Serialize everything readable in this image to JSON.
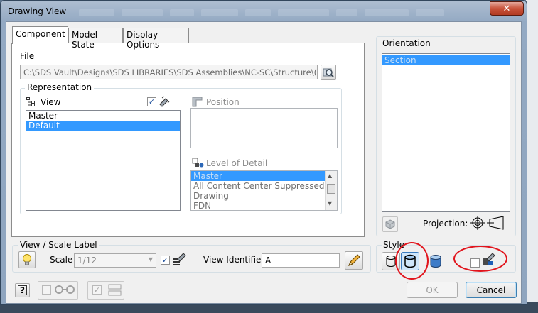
{
  "window": {
    "title": "Drawing View",
    "close_glyph": "✕"
  },
  "tabs": [
    {
      "label": "Component",
      "active": true
    },
    {
      "label": "Model State",
      "active": false
    },
    {
      "label": "Display Options",
      "active": false
    }
  ],
  "file": {
    "label": "File",
    "path": "C:\\SDS Vault\\Designs\\SDS LIBRARIES\\SDS Assemblies\\NC-SC\\Structure\\("
  },
  "representation": {
    "title": "Representation",
    "view": {
      "label": "View",
      "checked": true,
      "items": [
        {
          "label": "Master",
          "selected": false
        },
        {
          "label": "Default",
          "selected": true
        }
      ]
    },
    "position": {
      "label": "Position",
      "items": []
    },
    "level_of_detail": {
      "label": "Level of Detail",
      "items": [
        {
          "label": "Master",
          "selected": true
        },
        {
          "label": "All Content Center Suppressed",
          "selected": false
        },
        {
          "label": "Drawing",
          "selected": false
        },
        {
          "label": "FDN",
          "selected": false
        }
      ]
    }
  },
  "orientation": {
    "label": "Orientation",
    "items": [
      {
        "label": "Section",
        "selected": true
      }
    ],
    "projection_label": "Projection:"
  },
  "view_scale_label": {
    "title": "View / Scale Label",
    "scale_label": "Scale",
    "scale_value": "1/12",
    "view_identifier_label": "View Identifier",
    "view_identifier_value": "A"
  },
  "style": {
    "title": "Style"
  },
  "footer": {
    "ok_label": "OK",
    "cancel_label": "Cancel"
  },
  "colors": {
    "selection": "#3399ff",
    "annotation_red": "#e1141c",
    "title_bar": "#93a9c3"
  }
}
